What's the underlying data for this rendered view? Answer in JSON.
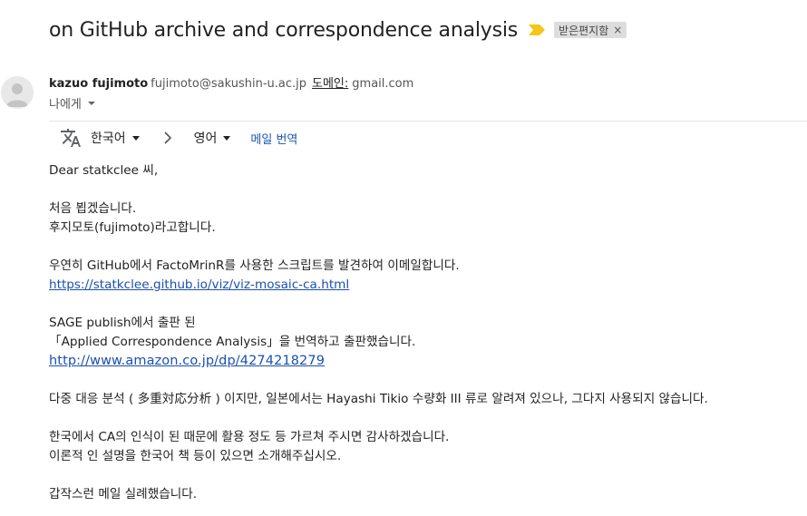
{
  "subject": "on GitHub archive and correspondence analysis",
  "importance_icon": "importance-marker-icon",
  "label": {
    "text": "받은편지함",
    "remove": "×",
    "color": "#dddddd"
  },
  "sender": {
    "name": "kazuo fujimoto",
    "email": "fujimoto@sakushin-u.ac.jp",
    "domain_label": "도메인:",
    "domain_value": "gmail.com",
    "to": "나에게"
  },
  "translate": {
    "source_lang": "한국어",
    "target_lang": "영어",
    "translate_button": "메일 번역"
  },
  "body": {
    "greeting": "Dear statkclee 씨,",
    "p1_line1": "처음 뵙겠습니다.",
    "p1_line2": "후지모토(fujimoto)라고합니다.",
    "p2_line1": "우연히 GitHub에서 FactoMrinR를 사용한 스크립트를 발견하여 이메일합니다.",
    "link1": "https://statkclee.github.io/viz/viz-mosaic-ca.html",
    "p3_line1": "SAGE publish에서 출판 된",
    "p3_line2": "「Applied Correspondence Analysis」을 번역하고 출판했습니다.",
    "link2": "http://www.amazon.co.jp/dp/4274218279",
    "p4": "다중 대응 분석 ( 多重対応分析 ) 이지만, 일본에서는 Hayashi Tikio 수량화 III 류로 알려져 있으나, 그다지 사용되지 않습니다.",
    "p5_line1": "한국에서 CA의 인식이 된 때문에 활용 정도 등 가르쳐 주시면 감사하겠습니다.",
    "p5_line2": "이론적 인 설명을 한국어 책 등이 있으면 소개해주십시오.",
    "closing": "갑작스런 메일 실례했습니다."
  },
  "colors": {
    "link": "#1a4fb0",
    "importance": "#f5c518"
  }
}
